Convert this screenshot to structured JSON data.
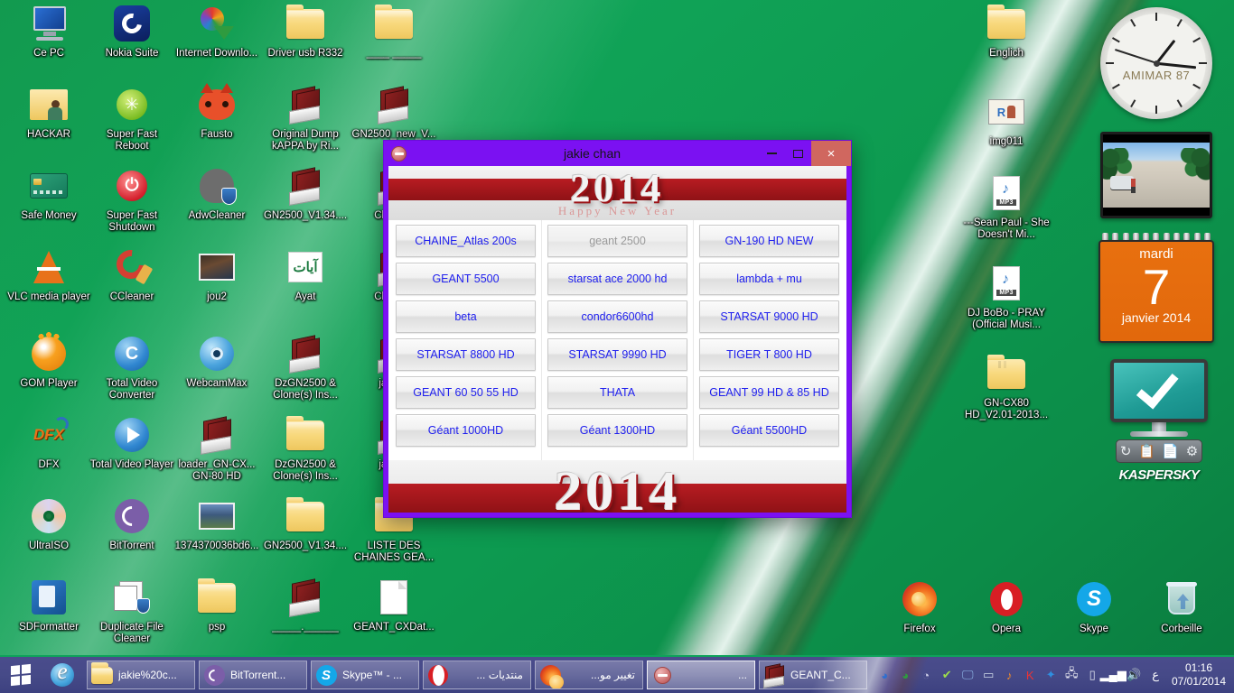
{
  "desktop": {
    "icons_left": [
      {
        "label": "Ce PC",
        "icon": "computer-icon"
      },
      {
        "label": "Nokia Suite",
        "icon": "nokia-suite-icon"
      },
      {
        "label": "Internet Downlo...",
        "icon": "internet-download-manager-icon"
      },
      {
        "label": "Driver usb R332",
        "icon": "folder-icon"
      },
      {
        "label": "____ _____",
        "icon": "folder-icon"
      },
      {
        "label": "HACKAR",
        "icon": "folder-user-icon"
      },
      {
        "label": "Super Fast Reboot",
        "icon": "reboot-icon"
      },
      {
        "label": "Fausto",
        "icon": "fausto-icon"
      },
      {
        "label": "Original Dump kAPPA by Ri...",
        "icon": "archive-icon"
      },
      {
        "label": "GN2500_new_V...",
        "icon": "archive-icon"
      },
      {
        "label": "Safe Money",
        "icon": "safe-money-icon"
      },
      {
        "label": "Super Fast Shutdown",
        "icon": "shutdown-icon"
      },
      {
        "label": "AdwCleaner",
        "icon": "adwcleaner-icon"
      },
      {
        "label": "GN2500_V1.34....",
        "icon": "archive-icon"
      },
      {
        "label": "Chann...",
        "icon": "archive-icon"
      },
      {
        "label": "VLC media player",
        "icon": "vlc-icon"
      },
      {
        "label": "CCleaner",
        "icon": "ccleaner-icon"
      },
      {
        "label": "jou2",
        "icon": "photo-icon"
      },
      {
        "label": "Ayat",
        "icon": "ayat-icon"
      },
      {
        "label": "Chann...",
        "icon": "archive-icon"
      },
      {
        "label": "GOM Player",
        "icon": "gom-player-icon"
      },
      {
        "label": "Total Video Converter",
        "icon": "total-video-converter-icon"
      },
      {
        "label": "WebcamMax",
        "icon": "webcammax-icon"
      },
      {
        "label": "DzGN2500 & Clone(s) Ins...",
        "icon": "archive-icon"
      },
      {
        "label": "jakie...",
        "icon": "archive-icon"
      },
      {
        "label": "DFX",
        "icon": "dfx-icon"
      },
      {
        "label": "Total Video Player",
        "icon": "total-video-player-icon"
      },
      {
        "label": "loader_GN-CX... GN-80 HD",
        "icon": "archive-icon"
      },
      {
        "label": "DzGN2500 & Clone(s) Ins...",
        "icon": "folder-icon"
      },
      {
        "label": "jakie...",
        "icon": "archive-icon"
      },
      {
        "label": "UltraISO",
        "icon": "ultraiso-icon"
      },
      {
        "label": "BitTorrent",
        "icon": "bittorrent-icon"
      },
      {
        "label": "1374370036bd6...",
        "icon": "photo-icon"
      },
      {
        "label": "GN2500_V1.34....",
        "icon": "folder-icon"
      },
      {
        "label": "LISTE DES CHAINES GEA...",
        "icon": "folder-icon"
      },
      {
        "label": "SDFormatter",
        "icon": "sdformatter-icon"
      },
      {
        "label": "Duplicate File Cleaner",
        "icon": "duplicate-file-cleaner-icon"
      },
      {
        "label": "psp",
        "icon": "folder-icon"
      },
      {
        "label": "_____.______",
        "icon": "archive-icon"
      },
      {
        "label": "GEANT_CXDat...",
        "icon": "document-icon"
      }
    ],
    "icons_right": [
      {
        "label": "Englich",
        "icon": "folder-icon"
      },
      {
        "label": "img011",
        "icon": "image-icon"
      },
      {
        "label": "---Sean Paul - She Doesn't Mi...",
        "icon": "mp3-icon"
      },
      {
        "label": "DJ BoBo - PRAY (Official Musi...",
        "icon": "mp3-icon"
      },
      {
        "label": "GN-CX80 HD_V2.01-2013...",
        "icon": "folder-multi-icon"
      }
    ],
    "icons_bottom": [
      {
        "label": "Firefox",
        "icon": "firefox-icon"
      },
      {
        "label": "Opera",
        "icon": "opera-icon"
      },
      {
        "label": "Skype",
        "icon": "skype-icon"
      },
      {
        "label": "Corbeille",
        "icon": "recycle-bin-icon"
      }
    ]
  },
  "gadgets": {
    "clock": {
      "brand": "AMIMAR 87",
      "hour": 1,
      "minute": 16,
      "second": 48
    },
    "calendar": {
      "weekday": "mardi",
      "day": "7",
      "month_year": "janvier 2014"
    },
    "kaspersky": {
      "brand": "KASPERSKY",
      "registered": "®",
      "buttons": [
        "refresh-icon",
        "tasks-icon",
        "report-icon",
        "settings-icon"
      ]
    }
  },
  "window": {
    "title": "jakie chan",
    "minimize_label": "–",
    "maximize_label": "❐",
    "close_label": "×",
    "banner": {
      "year": "2014",
      "greeting": "Happy New Year"
    },
    "columns": [
      {
        "buttons": [
          {
            "label": "CHAINE_Atlas 200s",
            "disabled": false
          },
          {
            "label": "GEANT 5500",
            "disabled": false
          },
          {
            "label": "beta",
            "disabled": false
          },
          {
            "label": "STARSAT 8800 HD",
            "disabled": false
          },
          {
            "label": "GEANT 60 50 55 HD",
            "disabled": false
          },
          {
            "label": "Géant 1000HD",
            "disabled": false
          }
        ]
      },
      {
        "buttons": [
          {
            "label": "geant 2500",
            "disabled": true
          },
          {
            "label": "starsat ace 2000 hd",
            "disabled": false
          },
          {
            "label": "condor6600hd",
            "disabled": false
          },
          {
            "label": "STARSAT 9990 HD",
            "disabled": false
          },
          {
            "label": "THATA",
            "disabled": false
          },
          {
            "label": "Géant 1300HD",
            "disabled": false
          }
        ]
      },
      {
        "buttons": [
          {
            "label": "GN-190 HD NEW",
            "disabled": false
          },
          {
            "label": "lambda + mu",
            "disabled": false
          },
          {
            "label": "STARSAT 9000 HD",
            "disabled": false
          },
          {
            "label": "TIGER T 800 HD",
            "disabled": false
          },
          {
            "label": "GEANT 99 HD & 85 HD",
            "disabled": false
          },
          {
            "label": "Géant 5500HD",
            "disabled": false
          }
        ]
      }
    ]
  },
  "taskbar": {
    "start_label": "start-button",
    "quick_launch": [
      {
        "label": "Internet Explorer",
        "icon": "internet-explorer-icon"
      }
    ],
    "tasks": [
      {
        "label": "jakie%20c...",
        "icon": "folder-icon",
        "active": false,
        "rtl": false
      },
      {
        "label": "BitTorrent...",
        "icon": "bittorrent-icon",
        "active": false,
        "rtl": false
      },
      {
        "label": "Skype™ - ...",
        "icon": "skype-icon",
        "active": false,
        "rtl": false
      },
      {
        "label": "منتديات ...",
        "icon": "opera-icon",
        "active": false,
        "rtl": true
      },
      {
        "label": "تغيير مو...",
        "icon": "firefox-icon",
        "active": false,
        "rtl": true
      },
      {
        "label": "...",
        "icon": "jakiechan-app-icon",
        "active": true,
        "rtl": true
      },
      {
        "label": "GEANT_C...",
        "icon": "archive-icon",
        "active": false,
        "rtl": false
      }
    ],
    "tray_icons": [
      "nokia-suite-tray-icon",
      "internet-download-manager-tray-icon",
      "bittorrent-tray-icon",
      "kaspersky-tray-icon",
      "display-tray-icon",
      "touchpad-tray-icon",
      "media-tray-icon",
      "kaspersky-shield-tray-icon",
      "bluetooth-tray-icon",
      "network-error-tray-icon",
      "usb-device-tray-icon",
      "signal-tray-icon",
      "volume-tray-icon"
    ],
    "language": "ع",
    "time": "01:16",
    "date": "07/01/2014"
  },
  "colors": {
    "desktop_green": "#11a458",
    "window_frame_purple": "#7b11f2",
    "button_text_blue": "#2020ee",
    "banner_red": "#b81c22",
    "calendar_orange": "#e8700f",
    "taskbar_blue": "#464a88"
  }
}
